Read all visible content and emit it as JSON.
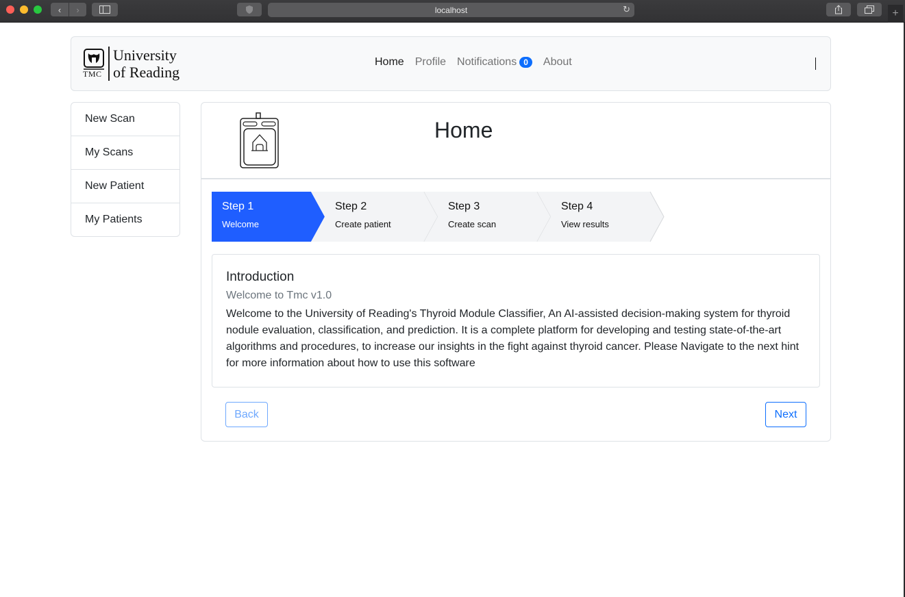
{
  "browser": {
    "url": "localhost"
  },
  "brand": {
    "name_line1": "University",
    "name_line2": "of Reading",
    "mark_text": "TMC"
  },
  "navbar": {
    "links": [
      {
        "label": "Home",
        "active": true
      },
      {
        "label": "Profile",
        "active": false
      },
      {
        "label": "Notifications",
        "active": false,
        "badge": "0"
      },
      {
        "label": "About",
        "active": false
      }
    ]
  },
  "sidebar": {
    "items": [
      {
        "label": "New Scan"
      },
      {
        "label": "My Scans"
      },
      {
        "label": "New Patient"
      },
      {
        "label": "My Patients"
      }
    ]
  },
  "page": {
    "title": "Home"
  },
  "stepper": {
    "steps": [
      {
        "title": "Step 1",
        "subtitle": "Welcome",
        "active": true
      },
      {
        "title": "Step 2",
        "subtitle": "Create patient",
        "active": false
      },
      {
        "title": "Step 3",
        "subtitle": "Create scan",
        "active": false
      },
      {
        "title": "Step 4",
        "subtitle": "View results",
        "active": false
      }
    ]
  },
  "intro": {
    "title": "Introduction",
    "subtitle": "Welcome to Tmc v1.0",
    "body": "Welcome to the University of Reading's Thyroid Module Classifier, An AI-assisted decision-making system for thyroid nodule evaluation, classification, and prediction. It is a complete platform for developing and testing state-of-the-art algorithms and procedures, to increase our insights in the fight against thyroid cancer. Please Navigate to the next hint for more information about how to use this software"
  },
  "actions": {
    "back_label": "Back",
    "next_label": "Next"
  },
  "colors": {
    "accent": "#0d6efd",
    "active_step": "#1f5eff",
    "inactive_step": "#f3f4f6"
  }
}
